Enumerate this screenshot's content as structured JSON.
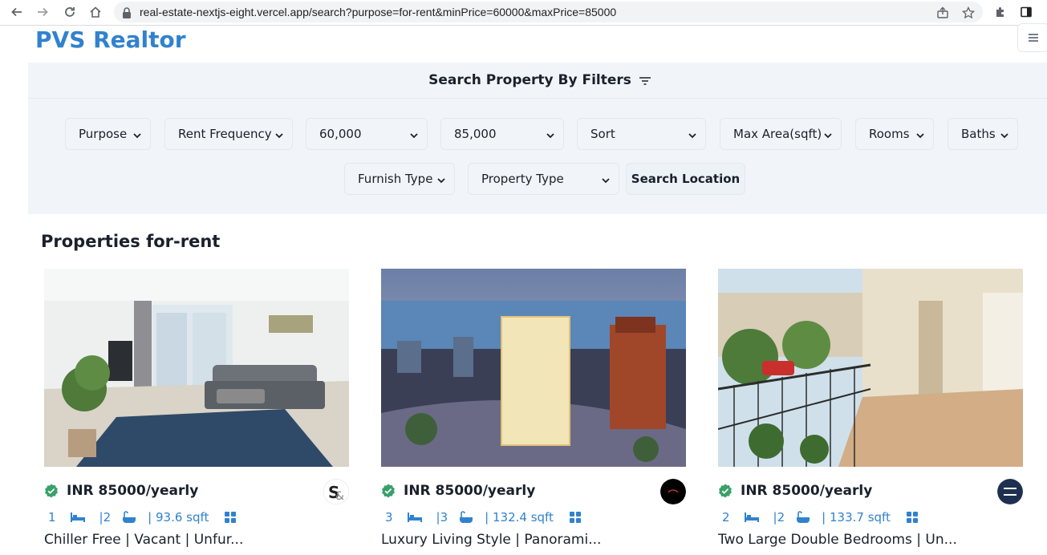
{
  "browser": {
    "url": "real-estate-nextjs-eight.vercel.app/search?purpose=for-rent&minPrice=60000&maxPrice=85000",
    "icons": [
      "back-icon",
      "forward-icon",
      "reload-icon",
      "home-icon",
      "lock-icon",
      "share-icon",
      "star-icon",
      "extension-icon",
      "sidepanel-icon"
    ]
  },
  "header": {
    "brand": "PVS Realtor",
    "brand_color": "#3182ce",
    "menu_icon": "hamburger-icon"
  },
  "filters": {
    "title": "Search Property By Filters",
    "title_icon": "filter-icon",
    "row1": [
      "Purpose",
      "Rent Frequency",
      "60,000",
      "85,000",
      "Sort",
      "Max Area(sqft)",
      "Rooms",
      "Baths"
    ],
    "row2": [
      "Furnish Type",
      "Property Type"
    ],
    "search_location": "Search Location"
  },
  "results": {
    "title": "Properties for-rent",
    "cards": [
      {
        "price": "INR 85000/yearly",
        "rooms": "1",
        "baths": "|2",
        "area": "| 93.6 sqft",
        "description": "Chiller Free | Vacant | Unfur...",
        "agency_icon": "agency-logo-s"
      },
      {
        "price": "INR 85000/yearly",
        "rooms": "3",
        "baths": "|3",
        "area": "| 132.4 sqft",
        "description": "Luxury Living Style | Panorami...",
        "agency_icon": "agency-logo-dark"
      },
      {
        "price": "INR 85000/yearly",
        "rooms": "2",
        "baths": "|2",
        "area": "| 133.7 sqft",
        "description": "Two Large Double Bedrooms | Un...",
        "agency_icon": "agency-logo-allsopp"
      }
    ]
  },
  "colors": {
    "accent": "#3182ce",
    "verified": "#38a169",
    "panel_bg": "#f1f5f9"
  }
}
